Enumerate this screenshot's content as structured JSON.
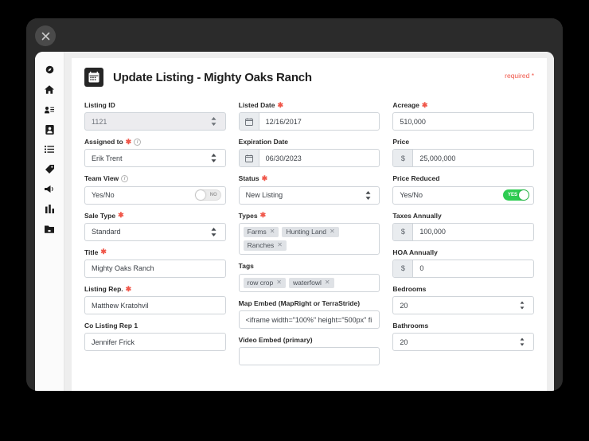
{
  "window": {
    "close_label": "close"
  },
  "sidebar": {
    "items": [
      {
        "name": "sidebar-item-dashboard",
        "icon": "compass-icon"
      },
      {
        "name": "sidebar-item-home",
        "icon": "home-icon"
      },
      {
        "name": "sidebar-item-contacts",
        "icon": "users-icon"
      },
      {
        "name": "sidebar-item-listings",
        "icon": "id-card-icon"
      },
      {
        "name": "sidebar-item-tasks",
        "icon": "list-icon"
      },
      {
        "name": "sidebar-item-tags",
        "icon": "tag-icon"
      },
      {
        "name": "sidebar-item-marketing",
        "icon": "megaphone-icon"
      },
      {
        "name": "sidebar-item-reports",
        "icon": "bar-chart-icon"
      },
      {
        "name": "sidebar-item-files",
        "icon": "folder-icon"
      }
    ]
  },
  "form": {
    "title": "Update Listing - Mighty Oaks Ranch",
    "header_icon": "calendar-icon",
    "required_note": "required *",
    "columns": {
      "left": [
        {
          "label": "Listing ID",
          "required": false,
          "info": false,
          "type": "select",
          "value": "1121",
          "disabled": true
        },
        {
          "label": "Assigned to",
          "required": true,
          "info": true,
          "type": "select",
          "value": "Erik Trent"
        },
        {
          "label": "Team View",
          "required": false,
          "info": true,
          "type": "toggle",
          "value": "Yes/No",
          "toggle_label": "NO",
          "toggle_on": false
        },
        {
          "label": "Sale Type",
          "required": true,
          "info": false,
          "type": "select",
          "value": "Standard"
        },
        {
          "label": "Title",
          "required": true,
          "info": false,
          "type": "text",
          "value": "Mighty Oaks Ranch"
        },
        {
          "label": "Listing Rep.",
          "required": true,
          "info": false,
          "type": "text",
          "value": "Matthew Kratohvil"
        },
        {
          "label": "Co Listing Rep 1",
          "required": false,
          "info": false,
          "type": "text",
          "value": "Jennifer Frick"
        }
      ],
      "middle": [
        {
          "label": "Listed Date",
          "required": true,
          "info": false,
          "type": "date",
          "value": "12/16/2017",
          "addon": "calendar-icon"
        },
        {
          "label": "Expiration Date",
          "required": false,
          "info": false,
          "type": "date",
          "value": "06/30/2023",
          "addon": "calendar-icon"
        },
        {
          "label": "Status",
          "required": true,
          "info": false,
          "type": "select",
          "value": "New Listing"
        },
        {
          "label": "Types",
          "required": true,
          "info": false,
          "type": "tokens",
          "tokens": [
            "Farms",
            "Hunting Land",
            "Ranches"
          ]
        },
        {
          "label": "Tags",
          "required": false,
          "info": false,
          "type": "tokens",
          "tokens": [
            "row crop",
            "waterfowl"
          ]
        },
        {
          "label": "Map Embed (MapRight or TerraStride)",
          "required": false,
          "info": false,
          "type": "text",
          "value": "<iframe width=\"100%\" height=\"500px\" fi"
        },
        {
          "label": "Video Embed (primary)",
          "required": false,
          "info": false,
          "type": "text",
          "value": ""
        }
      ],
      "right": [
        {
          "label": "Acreage",
          "required": true,
          "info": false,
          "type": "text",
          "value": "510,000"
        },
        {
          "label": "Price",
          "required": false,
          "info": false,
          "type": "currency",
          "value": "25,000,000",
          "addon": "$"
        },
        {
          "label": "Price Reduced",
          "required": false,
          "info": false,
          "type": "toggle",
          "value": "Yes/No",
          "toggle_label": "YES",
          "toggle_on": true
        },
        {
          "label": "Taxes Annually",
          "required": false,
          "info": false,
          "type": "currency",
          "value": "100,000",
          "addon": "$"
        },
        {
          "label": "HOA Annually",
          "required": false,
          "info": false,
          "type": "currency",
          "value": "0",
          "addon": "$"
        },
        {
          "label": "Bedrooms",
          "required": false,
          "info": false,
          "type": "number",
          "value": "20"
        },
        {
          "label": "Bathrooms",
          "required": false,
          "info": false,
          "type": "number",
          "value": "20"
        }
      ]
    }
  },
  "colors": {
    "accent_red": "#f0574a",
    "toggle_on_green": "#2ecc52",
    "shell_dark": "#2b2b2b"
  }
}
